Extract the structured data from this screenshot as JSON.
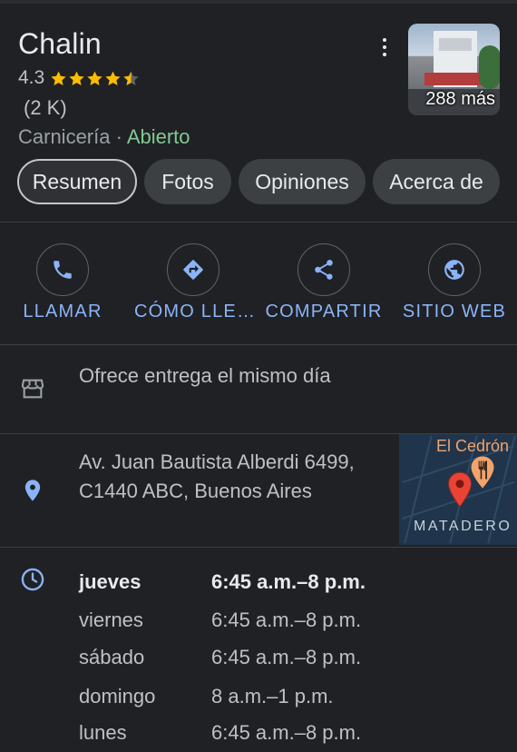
{
  "place": {
    "name": "Chalin",
    "rating": "4.3",
    "stars_value": 4.3,
    "reviews": "(2 K)",
    "category": "Carnicería",
    "separator": " · ",
    "status": "Abierto",
    "photos_more": "288 más"
  },
  "tabs": [
    {
      "label": "Resumen",
      "active": true
    },
    {
      "label": "Fotos"
    },
    {
      "label": "Opiniones"
    },
    {
      "label": "Acerca de"
    }
  ],
  "actions": [
    {
      "label": "LLAMAR",
      "icon": "phone-icon"
    },
    {
      "label": "CÓMO LLE…",
      "icon": "directions-icon"
    },
    {
      "label": "COMPARTIR",
      "icon": "share-icon"
    },
    {
      "label": "SITIO WEB",
      "icon": "globe-icon"
    }
  ],
  "delivery": {
    "text": "Ofrece entrega el mismo día",
    "icon": "storefront-icon"
  },
  "address": {
    "text": "Av. Juan Bautista Alberdi 6499, C1440 ABC, Buenos Aires",
    "icon": "location-pin-icon"
  },
  "map": {
    "poi_label": "El Cedrón",
    "district_label": "MATADERO"
  },
  "hours": [
    {
      "day": "jueves",
      "time": "6:45 a.m.–8 p.m.",
      "today": true
    },
    {
      "day": "viernes",
      "time": "6:45 a.m.–8 p.m."
    },
    {
      "day": "sábado",
      "time": "6:45 a.m.–8 p.m."
    },
    {
      "day": "domingo",
      "time": "8 a.m.–1 p.m."
    },
    {
      "day": "lunes",
      "time": "6:45 a.m.–8 p.m."
    }
  ],
  "colors": {
    "accent": "#8ab4f8",
    "open": "#81c995",
    "star": "#fbbc04",
    "background": "#202124"
  }
}
